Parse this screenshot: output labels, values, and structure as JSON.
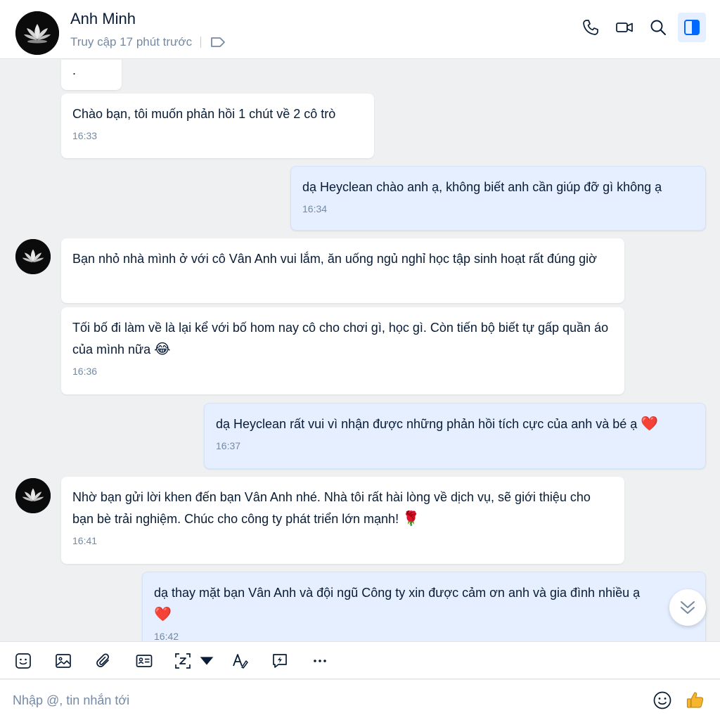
{
  "header": {
    "contact_name": "Anh Minh",
    "status": "Truy cập 17 phút trước"
  },
  "messages": [
    {
      "text": ".",
      "time": ""
    },
    {
      "text": "Chào bạn, tôi muốn phản hồi 1 chút về 2 cô trò",
      "time": "16:33"
    },
    {
      "text": "dạ Heyclean chào anh ạ, không biết anh cần giúp đỡ gì không ạ",
      "time": "16:34"
    },
    {
      "text": "Bạn nhỏ nhà mình ở với cô Vân Anh vui lắm, ăn uống ngủ nghỉ học tập sinh hoạt rất đúng giờ",
      "time": ""
    },
    {
      "text": "Tối bố đi làm về là lại kể với bố hom nay cô cho chơi gì, học gì. Còn tiến bộ biết tự gấp quần áo của mình nữa",
      "emoji": "😂",
      "time": "16:36"
    },
    {
      "text": "dạ Heyclean rất vui vì nhận được những phản hồi tích cực của anh và bé ạ",
      "emoji": "❤️",
      "time": "16:37"
    },
    {
      "text": "Nhờ bạn gửi lời khen đến bạn Vân Anh nhé. Nhà tôi rất hài lòng về dịch vụ, sẽ giới thiệu cho bạn bè trải nghiệm. Chúc cho công ty phát triển lớn mạnh!",
      "emoji": "🌹",
      "time": "16:41"
    },
    {
      "text": "dạ thay mặt bạn Vân Anh và đội ngũ Công ty xin được cảm ơn anh và gia đình nhiều ạ",
      "emoji": "❤️",
      "time": "16:42"
    }
  ],
  "composer": {
    "placeholder": "Nhập @, tin nhắn tới"
  },
  "colors": {
    "accent": "#0068ff",
    "my_bubble": "#e5efff",
    "their_bubble": "#ffffff",
    "chat_bg": "#eef0f1",
    "muted_text": "#7589a3"
  }
}
